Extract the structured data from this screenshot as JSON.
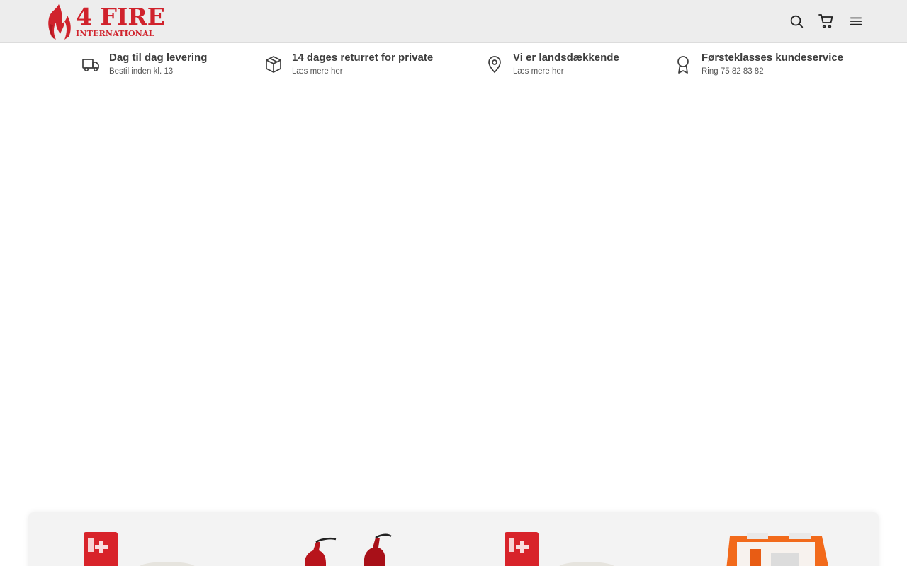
{
  "header": {
    "logo": {
      "main": "4 FIRE",
      "sub": "INTERNATIONAL",
      "brand_color": "#d0222c"
    },
    "icons": [
      "search-icon",
      "cart-icon",
      "menu-icon"
    ]
  },
  "usps": [
    {
      "icon": "truck-icon",
      "title": "Dag til dag levering",
      "subtitle": "Bestil inden kl. 13"
    },
    {
      "icon": "box-icon",
      "title": "14 dages returret for private",
      "subtitle": "Læs mere her"
    },
    {
      "icon": "map-pin-icon",
      "title": "Vi er landsdækkende",
      "subtitle": "Læs mere her"
    },
    {
      "icon": "award-icon",
      "title": "Førsteklasses kundeservice",
      "subtitle": "Ring 75 82 83 82"
    }
  ],
  "products": [
    {
      "image": "spray-extinguisher-and-smoke-detector"
    },
    {
      "image": "fire-extinguishers"
    },
    {
      "image": "spray-extinguisher-and-smoke-detector"
    },
    {
      "image": "first-aid-kit"
    }
  ]
}
